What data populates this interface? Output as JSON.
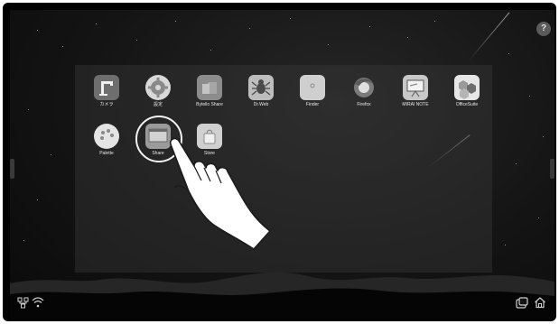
{
  "apps": [
    {
      "label": "カメラ",
      "icon": "camera-icon"
    },
    {
      "label": "設定",
      "icon": "gear-icon"
    },
    {
      "label": "Bytello Share",
      "icon": "folder-icon"
    },
    {
      "label": "Dr.Web",
      "icon": "spider-icon"
    },
    {
      "label": "Finder",
      "icon": "finder-icon"
    },
    {
      "label": "Firefox",
      "icon": "firefox-icon"
    },
    {
      "label": "MIRAI NOTE",
      "icon": "whiteboard-icon"
    },
    {
      "label": "OfficeSuite",
      "icon": "hexagon-icon"
    },
    {
      "label": "Palette",
      "icon": "palette-icon"
    },
    {
      "label": "Share",
      "icon": "share-screen-icon"
    },
    {
      "label": "Store",
      "icon": "store-bag-icon"
    }
  ],
  "system": {
    "help_label": "?",
    "network_icon": "network-icon",
    "wifi_icon": "wifi-icon",
    "window_switch_icon": "window-switch-icon",
    "home_icon": "home-icon"
  },
  "highlight": {
    "app": "Share",
    "gesture": "hand-pointer-icon"
  },
  "colors": {
    "background": "#141414",
    "tile": "#d6d6d6",
    "label": "#e8e8e8"
  }
}
